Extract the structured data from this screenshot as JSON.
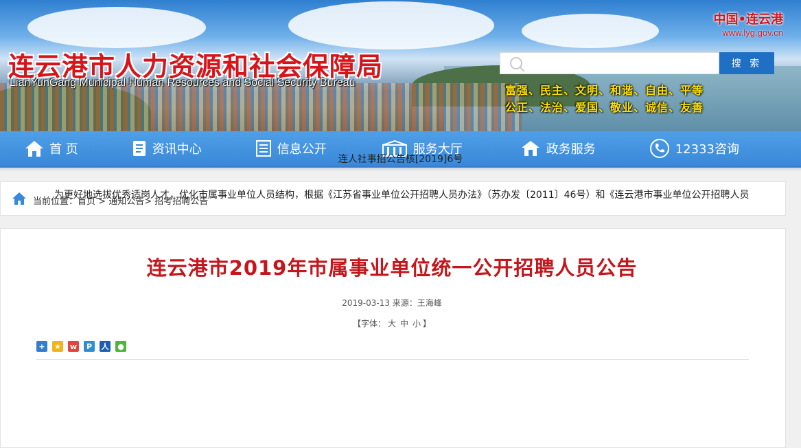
{
  "header": {
    "title": "连云港市人力资源和社会保障局",
    "subtitle": "LianYunGang Municipal Human Resources and Social Security Bureau",
    "gov_logo_text": "中国•连云港",
    "gov_logo_url": "www.lyg.gov.cn",
    "search_placeholder": "",
    "search_button": "搜 索",
    "slogan_line1": "富强、民主、文明、和谐、自由、平等",
    "slogan_line2": "公正、法治、爱国、敬业、诚信、友善"
  },
  "nav": {
    "items": [
      {
        "label": "首 页",
        "icon": "home-icon"
      },
      {
        "label": "资讯中心",
        "icon": "news-icon"
      },
      {
        "label": "信息公开",
        "icon": "list-icon"
      },
      {
        "label": "服务大厅",
        "icon": "hall-icon"
      },
      {
        "label": "政务服务",
        "icon": "gov-service-icon"
      },
      {
        "label": "12333咨询",
        "icon": "phone-icon"
      }
    ]
  },
  "breadcrumb": {
    "prefix": "当前位置：",
    "items": [
      "首页",
      "通知公告",
      "招考招聘公告"
    ],
    "sep1": " > ",
    "sep2": "> "
  },
  "article": {
    "title": "连云港市2019年市属事业单位统一公开招聘人员公告",
    "meta": "2019-03-13 来源：王海峰",
    "font_prefix": "【字体：",
    "font_large": "大",
    "font_medium": "中",
    "font_small": "小",
    "font_suffix": "】",
    "share_icons": [
      "share-more-icon",
      "share-qzone-icon",
      "share-weibo-icon",
      "share-tencent-icon",
      "share-renren-icon",
      "share-wechat-icon"
    ],
    "doc_number": "连人社事招公告核[2019]6号",
    "paragraph": "为更好地选拔优秀适岗人才，优化市属事业单位人员结构，根据《江苏省事业单位公开招聘人员办法》（苏办发〔2011〕46号）和《连云港市事业单位公开招聘人员"
  },
  "colors": {
    "title_red": "#c4161c",
    "nav_blue": "#3a88d8",
    "slogan_yellow": "#ffe200"
  }
}
